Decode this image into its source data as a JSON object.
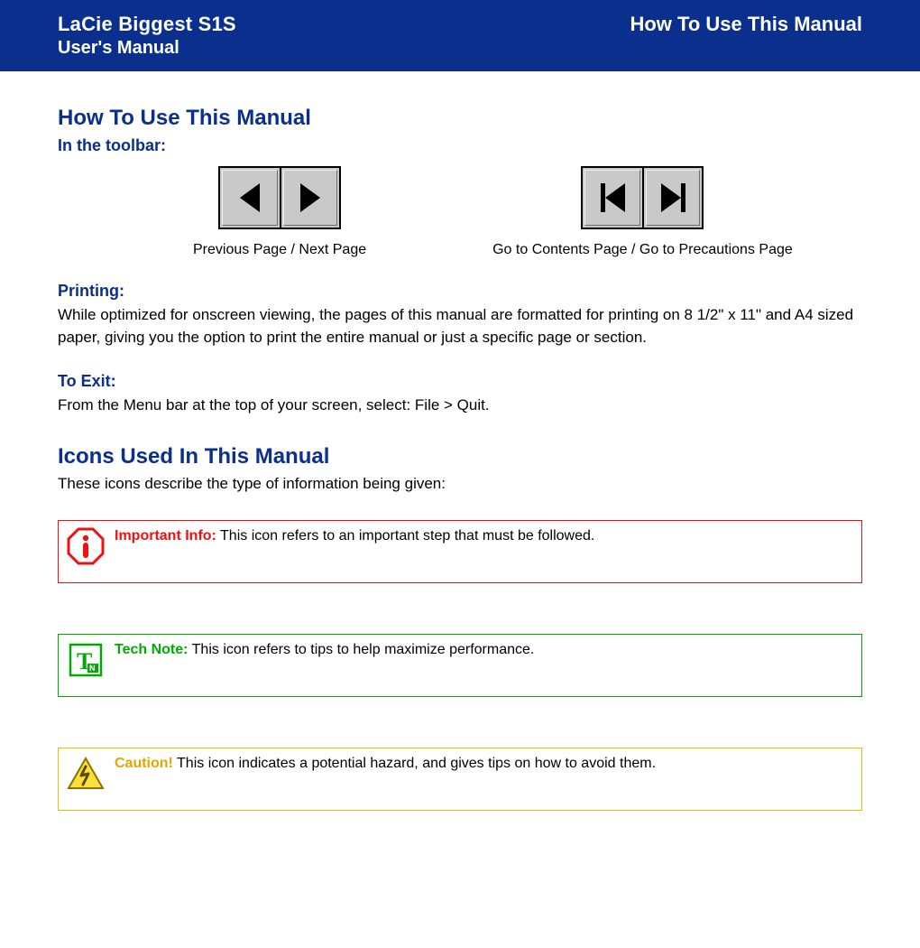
{
  "banner": {
    "product": "LaCie Biggest S1S",
    "subtitle": "User's Manual",
    "right_title": "How To Use This Manual"
  },
  "section1": {
    "title": "How To Use This Manual",
    "toolbar_label": "In the toolbar:",
    "prev_next_caption": "Previous Page / Next Page",
    "contents_caution_caption": "Go to Contents Page / Go to Precautions Page",
    "printing_label": "Printing:",
    "printing_text": "While optimized for onscreen viewing, the pages of this manual are formatted for printing on 8 1/2\" x 11\" and A4 sized paper, giving you the option to print the entire manual or just a specific page or section.",
    "exit_label": "To Exit:",
    "exit_text": "From the Menu bar at the top of your screen, select: File > Quit."
  },
  "section2": {
    "title": "Icons Used In This Manual",
    "intro": "These icons describe the type of information being given:",
    "important_label": "Important Info:",
    "important_text": " This icon refers to an important step that must be followed.",
    "tech_label": "Tech Note:",
    "tech_text": " This icon refers to tips to help maximize performance.",
    "caution_label": "Caution!",
    "caution_text": " This icon indicates a potential hazard, and gives tips on how to avoid them."
  }
}
